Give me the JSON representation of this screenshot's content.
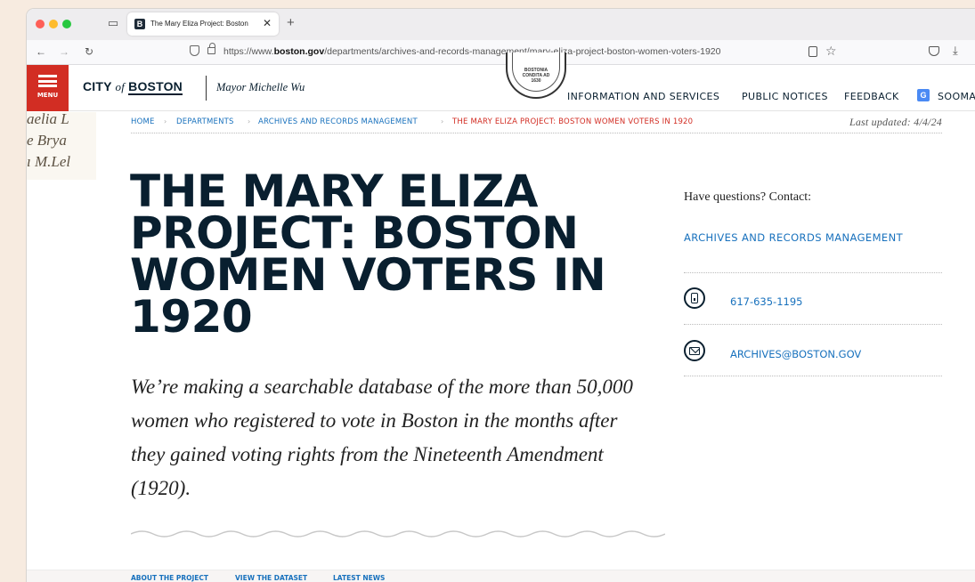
{
  "browser": {
    "tab_title": "The Mary Eliza Project: Boston",
    "favicon_letter": "B",
    "tab_close": "✕",
    "new_tab": "+",
    "url_prefix": "https://www.",
    "url_domain": "boston.gov",
    "url_path": "/departments/archives-and-records-management/mary-eliza-project-boston-women-voters-1920",
    "icons": [
      "traffic-lights",
      "tab-overview-icon",
      "back-arrow-icon",
      "forward-arrow-icon",
      "reload-icon",
      "shield-icon",
      "lock-icon",
      "reader-view-icon",
      "bookmark-star-icon",
      "pocket-icon",
      "download-icon"
    ]
  },
  "header": {
    "menu_label": "MENU",
    "logo_city": "CITY",
    "logo_of": "of",
    "logo_boston": "BOSTON",
    "mayor": "Mayor Michelle Wu",
    "seal_lines": [
      "BOSTONIA",
      "CONDITA AD",
      "1630"
    ],
    "nav": [
      "INFORMATION AND SERVICES",
      "PUBLIC NOTICES",
      "FEEDBACK"
    ],
    "translate_label": "SOOMA",
    "menu_color": "#d22d23"
  },
  "handwriting": [
    "aelia L",
    "e Brya",
    "ı M.Lel"
  ],
  "breadcrumb": {
    "items": [
      "HOME",
      "DEPARTMENTS",
      "ARCHIVES AND RECORDS MANAGEMENT",
      "THE MARY ELIZA PROJECT: BOSTON WOMEN VOTERS IN 1920"
    ],
    "separator": "›",
    "last_updated": "Last updated: 4/4/24"
  },
  "main": {
    "title": "THE MARY ELIZA PROJECT: BOSTON WOMEN VOTERS IN 1920",
    "intro": "We’re making a searchable database of the more than 50,000 women who registered to vote in Boston in the months after they gained voting rights from the Nineteenth Amendment (1920)."
  },
  "sidebar": {
    "heading": "Have questions? Contact:",
    "department": "ARCHIVES AND RECORDS MANAGEMENT",
    "phone": "617-635-1195",
    "email": "ARCHIVES@BOSTON.GOV"
  },
  "subnav": [
    "ABOUT THE PROJECT",
    "VIEW THE DATASET",
    "LATEST NEWS"
  ],
  "colors": {
    "navy": "#091f2f",
    "link_blue": "#1871bd",
    "accent_red": "#d22d23",
    "backdrop": "#f7ebe0"
  }
}
